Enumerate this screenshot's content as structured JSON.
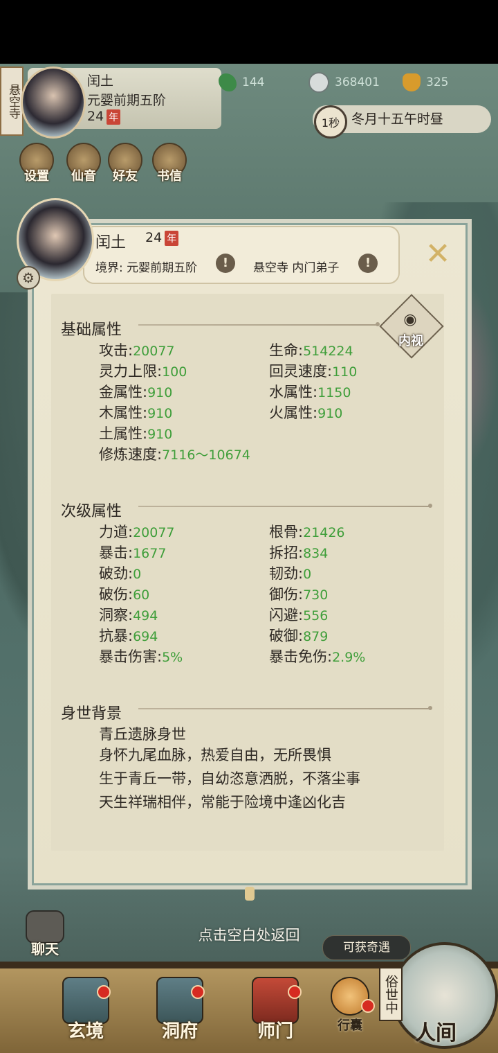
{
  "header": {
    "sect": "悬空寺",
    "name": "闰土",
    "realm": "元婴前期五阶",
    "age": "24",
    "nian": "年",
    "resources": {
      "jade": "144",
      "coin": "368401",
      "gold": "325"
    },
    "speed": "1秒",
    "time": "冬月十五午时昼",
    "quick": [
      {
        "label": "设置"
      },
      {
        "label": "仙音"
      },
      {
        "label": "好友"
      },
      {
        "label": "书信"
      }
    ]
  },
  "panel": {
    "name": "闰土",
    "age": "24",
    "nian": "年",
    "realm": "境界: 元婴前期五阶",
    "sect_rank": "悬空寺 内门弟子",
    "warn": "!",
    "inner_view": "内视",
    "basic": {
      "title": "基础属性",
      "stats": [
        {
          "label": "攻击",
          "value": "20077"
        },
        {
          "label": "生命",
          "value": "514224"
        },
        {
          "label": "灵力上限",
          "value": "100"
        },
        {
          "label": "回灵速度",
          "value": "110"
        },
        {
          "label": "金属性",
          "value": "910"
        },
        {
          "label": "水属性",
          "value": "1150"
        },
        {
          "label": "木属性",
          "value": "910"
        },
        {
          "label": "火属性",
          "value": "910"
        },
        {
          "label": "土属性",
          "value": "910"
        },
        {
          "label": "修炼速度",
          "value": "7116～10674"
        }
      ]
    },
    "secondary": {
      "title": "次级属性",
      "stats": [
        {
          "label": "力道",
          "value": "20077"
        },
        {
          "label": "根骨",
          "value": "21426"
        },
        {
          "label": "暴击",
          "value": "1677"
        },
        {
          "label": "拆招",
          "value": "834"
        },
        {
          "label": "破劲",
          "value": "0"
        },
        {
          "label": "韧劲",
          "value": "0"
        },
        {
          "label": "破伤",
          "value": "60"
        },
        {
          "label": "御伤",
          "value": "730"
        },
        {
          "label": "洞察",
          "value": "494"
        },
        {
          "label": "闪避",
          "value": "556"
        },
        {
          "label": "抗暴",
          "value": "694"
        },
        {
          "label": "破御",
          "value": "879"
        },
        {
          "label": "暴击伤害",
          "value": "5%"
        },
        {
          "label": "暴击免伤",
          "value": "2.9%"
        }
      ]
    },
    "background": {
      "title": "身世背景",
      "lines": [
        "青丘遗脉身世",
        "身怀九尾血脉，热爱自由，无所畏惧",
        "生于青丘一带，自幼恣意洒脱，不落尘事",
        "天生祥瑞相伴，常能于险境中逢凶化吉"
      ]
    }
  },
  "hint": "点击空白处返回",
  "chat": "聊天",
  "adventure": "可获奇遇",
  "tabs": [
    {
      "label": "玄境"
    },
    {
      "label": "洞府"
    },
    {
      "label": "师门"
    },
    {
      "label": "行囊"
    }
  ],
  "world": {
    "tag": "俗世中",
    "label": "人间"
  },
  "colors": {
    "stat_value": "#3f9e3a",
    "badge": "#c94536",
    "alert_dot": "#d62b21"
  }
}
